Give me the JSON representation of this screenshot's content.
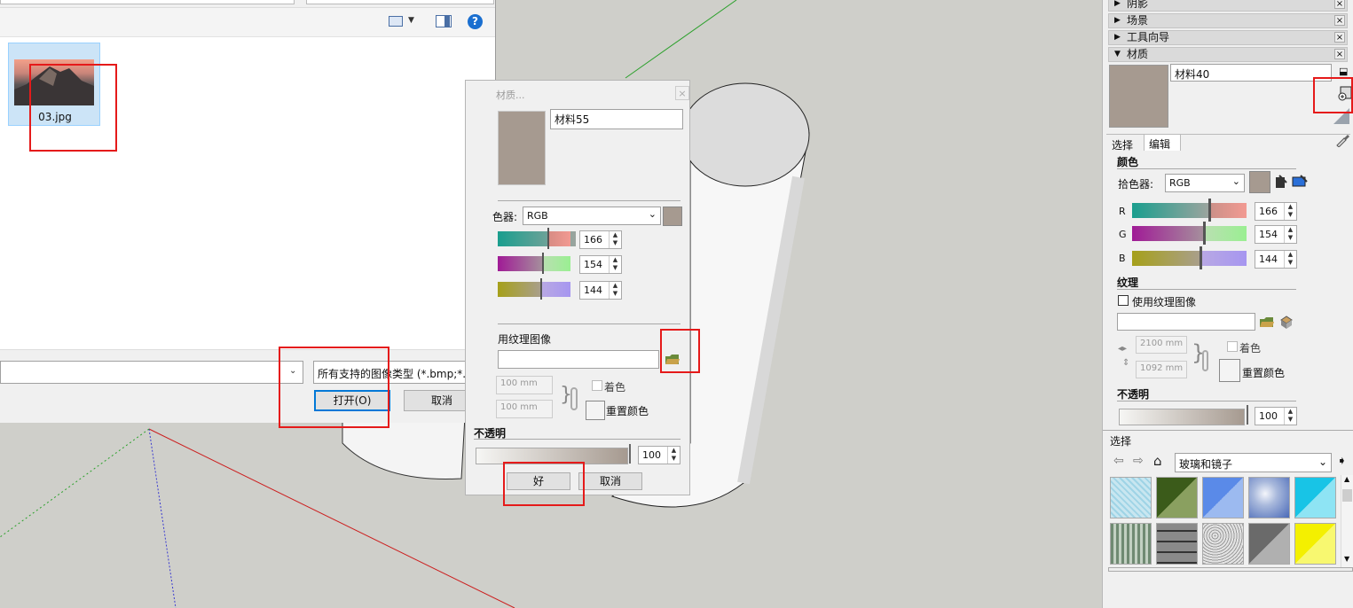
{
  "file_dialog": {
    "file_name": "03.jpg",
    "filename_value": "",
    "filetype_label": "所有支持的图像类型 (*.bmp;*.j",
    "open_label": "打开(O)",
    "cancel_label": "取消"
  },
  "material_dialog": {
    "title": "材质...",
    "name_value": "材料55",
    "picker_label": "色器:",
    "picker_mode": "RGB",
    "r_value": "166",
    "g_value": "154",
    "b_value": "144",
    "texture_label": "用纹理图像",
    "width_value": "100 mm",
    "height_value": "100 mm",
    "colorize_label": "着色",
    "reset_color_label": "重置颜色",
    "opacity_label": "不透明",
    "opacity_value": "100",
    "ok_label": "好",
    "cancel_label": "取消"
  },
  "tray": {
    "panels": [
      "阴影",
      "场景",
      "工具向导",
      "材质"
    ],
    "material_name": "材料40",
    "tab_select": "选择",
    "tab_edit": "编辑",
    "color_heading": "颜色",
    "picker_label": "拾色器:",
    "picker_mode": "RGB",
    "r_label": "R",
    "g_label": "G",
    "b_label": "B",
    "r_value": "166",
    "g_value": "154",
    "b_value": "144",
    "texture_heading": "纹理",
    "use_texture_label": "使用纹理图像",
    "width_value": "2100 mm",
    "height_value": "1092 mm",
    "colorize_label": "着色",
    "reset_color_label": "重置颜色",
    "opacity_heading": "不透明",
    "opacity_value": "100",
    "select_heading": "选择",
    "library_name": "玻璃和镜子"
  },
  "colors": {
    "material_color": "#a69a90",
    "highlight_red": "#e51a1a"
  }
}
